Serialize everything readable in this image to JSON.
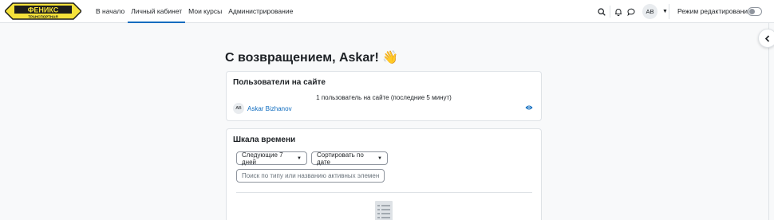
{
  "brand": {
    "logo_name": "ФЕНИКС",
    "logo_sub": "ТРАНСПОРТНАЯ"
  },
  "nav": {
    "links": [
      {
        "label": "В начало",
        "active": false
      },
      {
        "label": "Личный кабинет",
        "active": true
      },
      {
        "label": "Мои курсы",
        "active": false
      },
      {
        "label": "Администрирование",
        "active": false
      }
    ],
    "user_initials": "AB",
    "edit_mode_label": "Режим редактирования",
    "edit_mode_on": false
  },
  "colors": {
    "accent": "#0f6cbf",
    "logo_yellow": "#f5e23a",
    "logo_dark": "#1d1d1b"
  },
  "page_title": "С возвращением, Askar! 👋",
  "online_users": {
    "title": "Пользователи на сайте",
    "count_text": "1 пользователь на сайте (последние 5 минут)",
    "users": [
      {
        "initials": "AB",
        "name": "Askar Bizhanov"
      }
    ]
  },
  "timeline": {
    "title": "Шкала времени",
    "filter_label": "Следующие 7 дней",
    "sort_label": "Сортировать по дате",
    "search_placeholder": "Поиск по типу или названию активных элементов"
  }
}
